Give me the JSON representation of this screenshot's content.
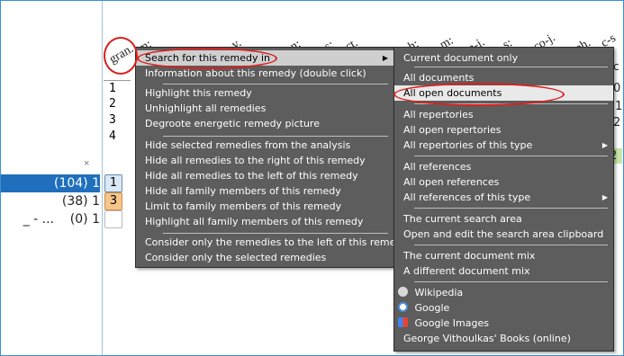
{
  "left_panel": {
    "close_glyph": "×",
    "rows": [
      {
        "text": "(104) 1",
        "selected": true
      },
      {
        "text": "(38) 1",
        "selected": false
      },
      {
        "text": "_ - ...    (0) 1",
        "selected": false
      }
    ]
  },
  "header": {
    "remedies": [
      "gran.",
      "m:",
      "v.",
      "n:",
      "s:",
      "ct.",
      "h:",
      "m:",
      "n-i.",
      "s:",
      "co-j.",
      "ph.",
      "c-s"
    ],
    "row_numbers": [
      "1",
      "2",
      "3",
      "4"
    ],
    "right_fragments": [
      "0",
      "1",
      "2",
      "c"
    ]
  },
  "badges": [
    {
      "value": "1",
      "bg": "#dbe8f5"
    },
    {
      "value": "3",
      "bg": "#f6c58a"
    },
    {
      "value": "",
      "bg": "#ffffff"
    }
  ],
  "highlight_value": "2",
  "context_menu": {
    "items": [
      {
        "label": "Search for this remedy in",
        "submenu": true
      },
      {
        "label": "Information about this remedy (double click)"
      },
      {
        "label": "Highlight this remedy"
      },
      {
        "label": "Unhighlight all remedies"
      },
      {
        "label": "Degroote energetic remedy picture"
      },
      {
        "label": "Hide selected remedies from the analysis"
      },
      {
        "label": "Hide all remedies to the right of this remedy"
      },
      {
        "label": "Hide all remedies to the left of this remedy"
      },
      {
        "label": "Hide all family members of this remedy"
      },
      {
        "label": "Limit to family members of this remedy"
      },
      {
        "label": "Highlight all family members of this remedy"
      },
      {
        "label": "Consider only the remedies to the left of this remedy"
      },
      {
        "label": "Consider only the selected remedies"
      }
    ]
  },
  "submenu": {
    "items": [
      {
        "label": "Current document only"
      },
      {
        "label": "All documents"
      },
      {
        "label": "All open documents"
      },
      {
        "label": "All repertories"
      },
      {
        "label": "All open repertories"
      },
      {
        "label": "All repertories of this type",
        "submenu": true
      },
      {
        "label": "All references"
      },
      {
        "label": "All open references"
      },
      {
        "label": "All references of this type",
        "submenu": true
      },
      {
        "label": "The current search area"
      },
      {
        "label": "Open and edit the search area clipboard"
      },
      {
        "label": "The current document mix"
      },
      {
        "label": "A different document mix"
      },
      {
        "label": "Wikipedia",
        "icon": "wikipedia-icon"
      },
      {
        "label": "Google",
        "icon": "google-icon"
      },
      {
        "label": "Google Images",
        "icon": "google-images-icon"
      },
      {
        "label": "George Vithoulkas' Books (online)"
      }
    ]
  },
  "colors": {
    "selection": "#1f6fbd",
    "menu_bg": "#5d5d5d",
    "annotation": "#d8211e"
  }
}
